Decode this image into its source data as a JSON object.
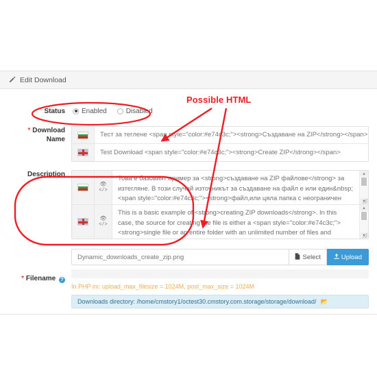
{
  "panel": {
    "heading": "Edit Download",
    "heading_icon": "pencil-icon"
  },
  "status": {
    "label": "Status",
    "options": [
      {
        "label": "Enabled",
        "checked": true
      },
      {
        "label": "Disabled",
        "checked": false
      }
    ]
  },
  "download_name": {
    "label_line1": "Download",
    "label_line2": "Name",
    "required_marker": "*",
    "rows": [
      {
        "flag": "flag-bulgaria-icon",
        "value": "Тест за теглене <span style=\"color:#e74c3c;\"><strong>Създаване на ZIP</strong></span>"
      },
      {
        "flag": "flag-english-icon",
        "value": "Test Download <span style=\"color:#e74c3c;\"><strong>Create ZIP</strong></span>"
      }
    ]
  },
  "description": {
    "label": "Description",
    "rows": [
      {
        "flag": "flag-bulgaria-icon",
        "preview_icon": "eye-icon",
        "source_icon": "code-icon",
        "value": "Това е базовият пример за <strong>създаване на ZIP файлове</strong> за изтегляне. В този случай източникът за създаване на файл е или един&nbsp; <span style=\"color:#e74c3c;\"><strong>файл,или цяла папка с неограничен брой"
      },
      {
        "flag": "flag-english-icon",
        "preview_icon": "eye-icon",
        "source_icon": "code-icon",
        "value": "This is a basic example of <strong>creating ZIP downloads</strong>. In this case, the source for creating the file is either a <span style=\"color:#e74c3c;\"><strong>single file or an entire folder with an unlimited number of files and subfolders</strong>"
      }
    ]
  },
  "filename": {
    "label": "Filename",
    "required_marker": "*",
    "help_icon": "help-circle-icon",
    "help_glyph": "?",
    "value": "Dynamic_downloads_create_zip.png",
    "select_button": "Select",
    "select_icon": "file-icon",
    "upload_button": "Upload",
    "upload_icon": "upload-icon",
    "php_ini_note": "In PHP ini: upload_max_filesize = 1024M, post_max_size = 1024M",
    "downloads_directory": "Downloads directory: /home/cmstory1/octest30.cmstory.com.storage/storage/download/",
    "directory_icon": "folder-open-icon"
  },
  "annotations": {
    "callout_text": "Possible HTML",
    "callout_color": "#ee1d23"
  },
  "colors": {
    "accent_blue": "#3c9bd6",
    "annotation_red": "#ee1d23",
    "required_red": "#e4473c",
    "warning_orange": "#f0ad4e",
    "info_bg": "#ddeef7"
  }
}
